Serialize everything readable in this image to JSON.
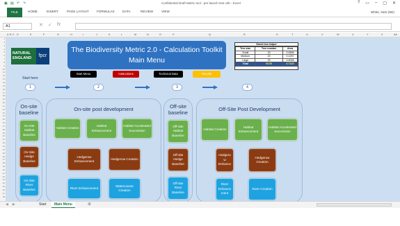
{
  "window": {
    "title": "Confidential Draft Metric tool - pre launch test v2b - Excel",
    "controls": [
      "?",
      "▭",
      "–",
      "▢",
      "✕"
    ]
  },
  "ribbon": {
    "tabs": [
      "FILE",
      "HOME",
      "INSERT",
      "PAGE LAYOUT",
      "FORMULAS",
      "DATA",
      "REVIEW",
      "VIEW"
    ],
    "user": "White, Nick (NE)"
  },
  "formula_bar": {
    "name_box": "A1",
    "value": ""
  },
  "columns": [
    "A",
    "B",
    "C",
    "D",
    "E",
    "F",
    "G",
    "H",
    "I",
    "J",
    "K",
    "L",
    "M",
    "N",
    "O",
    "P",
    "Q",
    "R",
    "S",
    "T",
    "U",
    "V",
    "W",
    "X",
    "Y",
    "Z",
    "AA"
  ],
  "rows": [
    "1",
    "2",
    "3",
    "4",
    "5",
    "6",
    "7",
    "8",
    "9",
    "10",
    "11",
    "12",
    "13",
    "14",
    "15",
    "16",
    "17",
    "18",
    "19",
    "20",
    "21",
    "22",
    "23",
    "24",
    "25",
    "26",
    "27",
    "28",
    "29",
    "30",
    "31",
    "32",
    "33",
    "34",
    "35",
    "36",
    "37",
    "38",
    "39",
    "40",
    "41",
    "42",
    "43",
    "44",
    "45",
    "46",
    "47",
    "48"
  ],
  "logo": {
    "natural_england": "NATURAL ENGLAND",
    "partner": "fpcr"
  },
  "banner": {
    "line1": "The Biodiversity Metric 2.0 - Calculation Toolkit",
    "line2": "Main Menu"
  },
  "tree_helper": {
    "title": "Street tree helper",
    "headers": [
      "Tree size",
      "Tree number",
      "Area"
    ],
    "rows": [
      [
        "Small",
        "20",
        "0.0836"
      ],
      [
        "Medium",
        "20",
        "0.1257"
      ],
      [
        "Large",
        "20",
        "0.4028"
      ]
    ],
    "total": [
      "Total",
      "60.00",
      "0.7123"
    ]
  },
  "nav_buttons": [
    {
      "label": "Start Menu",
      "bg": "#000000",
      "fg": "#ffffff"
    },
    {
      "label": "Instructions",
      "bg": "#c00000",
      "fg": "#ffffff"
    },
    {
      "label": "Technical Data",
      "bg": "#000000",
      "fg": "#ffffff"
    },
    {
      "label": "Results",
      "bg": "#ffc000",
      "fg": "#ffffff"
    }
  ],
  "start_here": "Start here",
  "steps": [
    "1",
    "2",
    "3",
    "4"
  ],
  "panels": {
    "onsite_baseline": {
      "title": "On-site baseline",
      "buttons": [
        "On-site Habitat Baseline",
        "On-Site Hedge Baseline",
        "On-Site River Baseline"
      ]
    },
    "onsite_post": {
      "title": "On-site post development",
      "habitat": [
        "Habitat Creation",
        "Habitat Enhancement",
        "Habitat Accelerated Succession"
      ],
      "hedge": [
        "Hedgerow Enhancement",
        "Hedgerow Creation"
      ],
      "river": [
        "River Enhancement",
        "Watercourse Creation"
      ]
    },
    "offsite_baseline": {
      "title": "Off-site baseline",
      "buttons": [
        "Off-Site Habitat Baseline",
        "Off-site Hedge Baseline",
        "Off-site River Baseline"
      ]
    },
    "offsite_post": {
      "title": "Off-Site Post Development",
      "habitat": [
        "Habitat Creation",
        "Habitat Enhancement",
        "Habitat Accelerated Succession"
      ],
      "hedge": [
        "Hedgero w Enhance",
        "Hedgerow Creation"
      ],
      "river": [
        "River Enhance ment",
        "River Creation"
      ]
    }
  },
  "sheet_tabs": [
    "Start",
    "Main Menu"
  ],
  "active_sheet": "Main Menu",
  "add_sheet": "⊕"
}
